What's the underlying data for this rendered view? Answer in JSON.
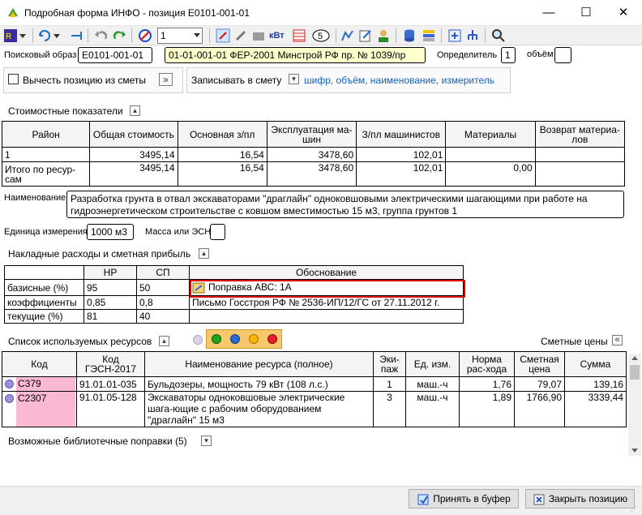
{
  "window": {
    "title": "Подробная форма ИНФО - позиция Е0101-001-01",
    "minimize": "—",
    "maximize": "☐",
    "close": "✕"
  },
  "toolbar": {
    "combo_value": "1"
  },
  "search": {
    "label": "Поисковый образ",
    "code": "Е0101-001-01",
    "norm_doc": "01-01-001-01 ФЕР-2001 Минстрой РФ пр. № 1039/пр",
    "determinant_label": "Определитель",
    "determinant_value": "1",
    "volume_label": "объём",
    "volume_value": ""
  },
  "options": {
    "exclude_label": "Вычесть позицию из сметы",
    "expand_btn": "»",
    "write_label": "Записывать в смету",
    "write_value": "шифр, объём, наименование, измеритель"
  },
  "cost": {
    "section_title": "Стоимостные показатели",
    "headers": [
      "Район",
      "Общая стоимость",
      "Основная з/пл",
      "Эксплуатация ма-шин",
      "З/пл машинистов",
      "Материалы",
      "Возврат материа-лов"
    ],
    "rows": [
      [
        "1",
        "3495,14",
        "16,54",
        "3478,60",
        "102,01",
        "",
        ""
      ],
      [
        "Итого по ресур-сам",
        "3495,14",
        "16,54",
        "3478,60",
        "102,01",
        "0,00",
        ""
      ]
    ]
  },
  "name": {
    "label": "Наименование",
    "value": "Разработка грунта в отвал экскаваторами \"драглайн\" одноковшовыми электрическими шагающими при работе на гидроэнергетическом строительстве с ковшом вместимостью 15 м3, группа грунтов 1"
  },
  "unit": {
    "label": "Единица измерения",
    "value": "1000 м3",
    "mass_label": "Масса или ЭСН",
    "mass_value": ""
  },
  "overhead": {
    "section_title": "Накладные расходы и сметная прибыль",
    "headers": [
      "",
      "НР",
      "СП",
      "Обоснование"
    ],
    "rows": [
      [
        "базисные (%)",
        "95",
        "50",
        "Поправка АВС: 1А"
      ],
      [
        "коэффициенты",
        "0,85",
        "0,8",
        "Письмо Госстроя РФ № 2536-ИП/12/ГС от 27.11.2012 г."
      ],
      [
        "текущие (%)",
        "81",
        "40",
        ""
      ]
    ]
  },
  "resources": {
    "section_title": "Список используемых ресурсов",
    "prices_label": "Сметные цены",
    "prices_btn": "«",
    "headers": [
      "Код",
      "Код ГЭСН-2017",
      "Наименование ресурса (полное)",
      "Эки-паж",
      "Ед. изм.",
      "Норма рас-хода",
      "Сметная цена",
      "Сумма"
    ],
    "rows": [
      [
        "С379",
        "91.01.01-035",
        "Бульдозеры, мощность 79 кВт (108 л.с.)",
        "1",
        "маш.-ч",
        "1,76",
        "79,07",
        "139,16"
      ],
      [
        "С2307",
        "91.01.05-128",
        "Экскаваторы одноковшовые электрические шага-ющие с рабочим оборудованием \"драглайн\" 15 м3",
        "3",
        "маш.-ч",
        "1,89",
        "1766,90",
        "3339,44"
      ]
    ],
    "colors": {
      "status_dot": "#9f8fdc",
      "code_cell": "#f9b8d4"
    }
  },
  "library": {
    "label": "Возможные библиотечные поправки (5)"
  },
  "buttons": {
    "accept": "Принять в буфер",
    "close": "Закрыть позицию"
  }
}
